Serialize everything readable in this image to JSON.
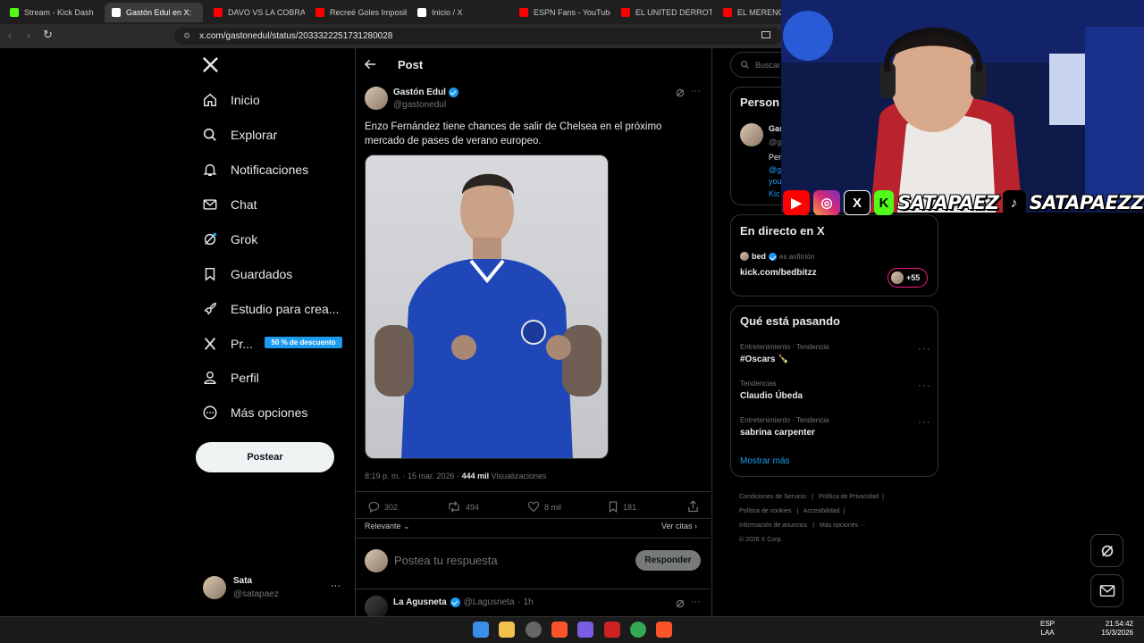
{
  "browser": {
    "tabs": [
      {
        "label": "Stream - Kick Dash",
        "color": "#53fc18",
        "active": false
      },
      {
        "label": "Gastón Edul en X: ",
        "color": "#ffffff",
        "active": true
      },
      {
        "label": "DAVO VS LA COBRA: ",
        "color": "#ff0000",
        "active": false
      },
      {
        "label": "Recreé Goles Imposib",
        "color": "#ff0000",
        "active": false
      },
      {
        "label": "Inicio / X",
        "color": "#ffffff",
        "active": false
      },
      {
        "label": "ESPN Fans - YouTube",
        "color": "#ff0000",
        "active": false
      },
      {
        "label": "EL UNITED DERROTÓ A",
        "color": "#ff0000",
        "active": false
      },
      {
        "label": "EL MERENGUE",
        "color": "#ff0000",
        "active": false
      }
    ],
    "url": "x.com/gastonedul/status/2033322251731280028"
  },
  "nav": {
    "items": [
      "Inicio",
      "Explorar",
      "Notificaciones",
      "Chat",
      "Grok",
      "Guardados",
      "Estudio para crea...",
      "Pr...",
      "Perfil",
      "Más opciones"
    ],
    "premium_badge": "50 % de descuento",
    "post_button": "Postear",
    "user": {
      "name": "Sata",
      "handle": "@satapaez",
      "more": "···"
    }
  },
  "post": {
    "header": "Post",
    "author_name": "Gastón Edul",
    "author_handle": "@gastonedul",
    "text": "Enzo Fernández tiene chances de salir de Chelsea en el próximo mercado de pases de verano europeo.",
    "timestamp": "8:19 p. m. · 15 mar. 2026 · ",
    "views_count": "444 mil",
    "views_label": " Visualizaciones",
    "replies": "302",
    "reposts": "494",
    "likes": "8 mil",
    "bookmarks": "181",
    "sort_label": "Relevante",
    "quotes_label": "Ver citas",
    "reply_placeholder": "Postea tu respuesta",
    "reply_button": "Responder"
  },
  "reply_preview": {
    "name": "La Agusneta",
    "handle": "@Lagusneta",
    "time": "· 1h"
  },
  "right": {
    "search_placeholder": "Buscar",
    "people_title": "Person",
    "people_snippet": [
      "Gas",
      "@g",
      "Per",
      "@g",
      "you",
      "Kic"
    ],
    "live_title": "En directo en X",
    "live_host": "bed",
    "live_host_suffix": "es anfitrión",
    "live_link": "kick.com/bedbitzz",
    "live_count": "+55",
    "trends_title": "Qué está pasando",
    "trends": [
      {
        "context": "Entretenimiento · Tendencia",
        "name": "#Oscars 🍾"
      },
      {
        "context": "Tendencias",
        "name": "Claudio Úbeda"
      },
      {
        "context": "Entretenimiento · Tendencia",
        "name": "sabrina carpenter"
      }
    ],
    "show_more": "Mostrar más",
    "footer": [
      "Condiciones de Servicio",
      "Política de Privacidad",
      "Política de cookies",
      "Accesibilidad",
      "Información de anuncios",
      "Más opciones ···",
      "© 2026 X Corp."
    ]
  },
  "overlay": {
    "handle1": "SATAPAEZ",
    "handle2": "SATAPAEZZ"
  },
  "taskbar": {
    "lang1": "ESP",
    "lang2": "LAA",
    "time": "21:54:42",
    "date": "15/3/2026"
  }
}
